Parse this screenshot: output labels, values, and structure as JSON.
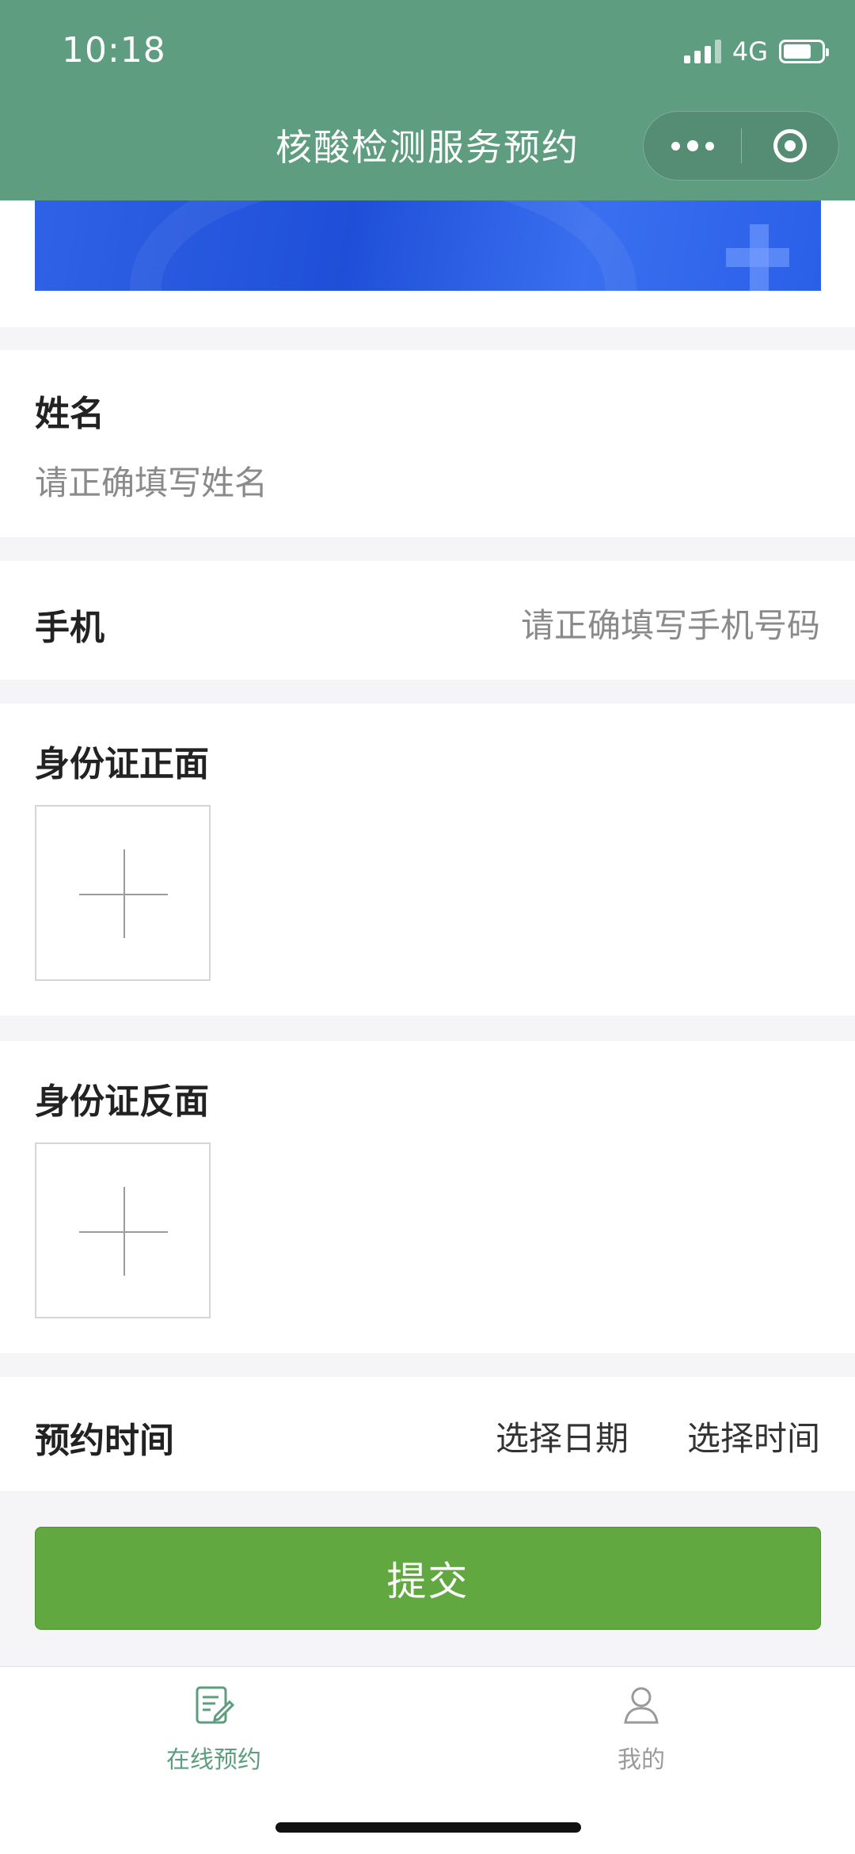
{
  "status_bar": {
    "time": "10:18",
    "network": "4G"
  },
  "nav": {
    "title": "核酸检测服务预约"
  },
  "form": {
    "name": {
      "label": "姓名",
      "placeholder": "请正确填写姓名"
    },
    "phone": {
      "label": "手机",
      "placeholder": "请正确填写手机号码"
    },
    "id_front": {
      "label": "身份证正面"
    },
    "id_back": {
      "label": "身份证反面"
    },
    "appointment": {
      "label": "预约时间",
      "date_placeholder": "选择日期",
      "time_placeholder": "选择时间"
    },
    "submit_label": "提交"
  },
  "tabbar": {
    "items": [
      {
        "label": "在线预约",
        "icon": "edit-note-icon",
        "active": true
      },
      {
        "label": "我的",
        "icon": "user-icon",
        "active": false
      }
    ]
  },
  "colors": {
    "header": "#5e9d80",
    "primary_button": "#62a841",
    "active_tab": "#5e9d80",
    "inactive_tab": "#9a9a9a"
  }
}
